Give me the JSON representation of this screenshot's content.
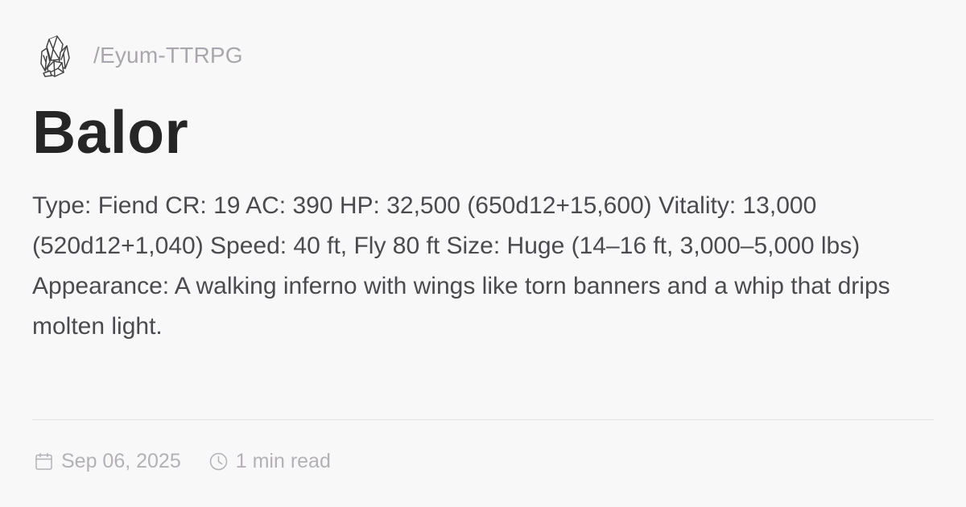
{
  "site": {
    "logo_icon": "crystal-cluster-icon",
    "name": "/Eyum-TTRPG"
  },
  "article": {
    "title": "Balor",
    "description": "Type: Fiend CR: 19 AC: 390 HP: 32,500 (650d12+15,600) Vitality: 13,000 (520d12+1,040) Speed: 40 ft, Fly 80 ft Size: Huge (14–16 ft, 3,000–5,000 lbs) Appearance: A walking inferno with wings like torn banners and a whip that drips molten light."
  },
  "meta": {
    "date_icon": "calendar-icon",
    "date": "Sep 06, 2025",
    "read_icon": "clock-icon",
    "read_time": "1 min read"
  },
  "colors": {
    "background": "#f9f8f9",
    "title": "#262626",
    "body_text": "#4b4a4e",
    "muted": "#b3b1b6",
    "divider": "#e4e3e6"
  }
}
